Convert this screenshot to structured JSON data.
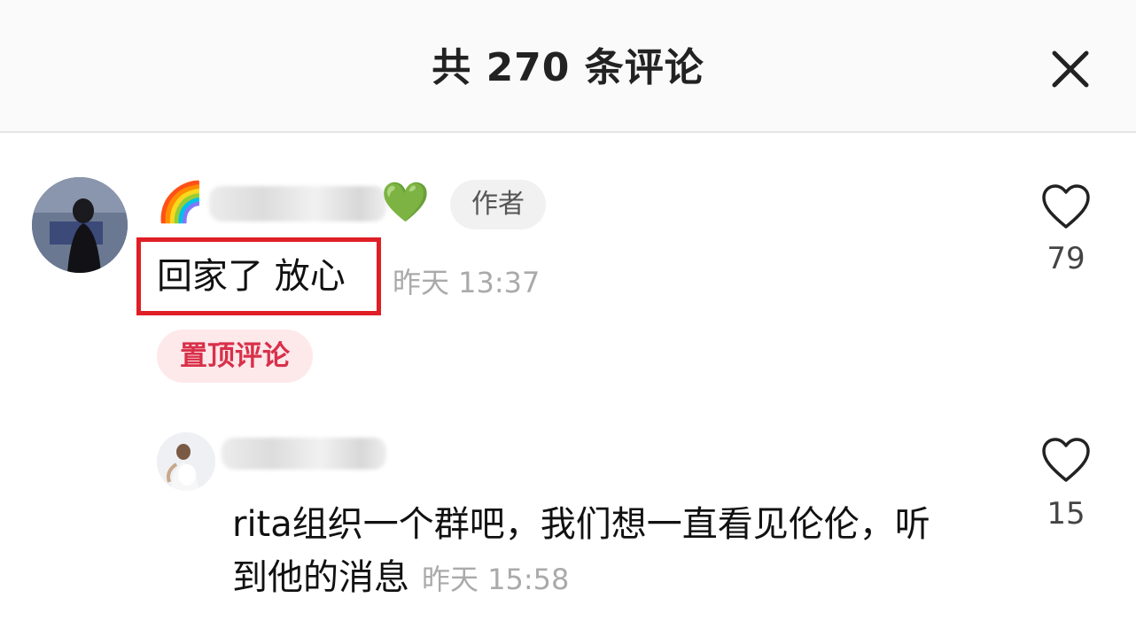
{
  "header": {
    "title": "共 270 条评论",
    "close_icon": "close-icon"
  },
  "comments": [
    {
      "author_badge": "作者",
      "name_emojis": [
        "🌈",
        "💚"
      ],
      "text": "回家了 放心",
      "time": "昨天 13:37",
      "pinned_label": "置顶评论",
      "likes": "79",
      "highlight_color": "#e01e26"
    },
    {
      "text": "rita组织一个群吧，我们想一直看见伦伦，听到他的消息",
      "time": "昨天 15:58",
      "likes": "15"
    }
  ],
  "colors": {
    "pin_bg": "#fde8ea",
    "pin_text": "#d9304a",
    "badge_bg": "#f1f1f1"
  }
}
